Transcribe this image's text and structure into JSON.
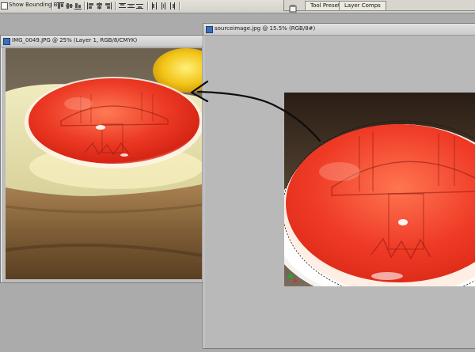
{
  "options_bar": {
    "show_bounding_box_label": "Show Bounding Box"
  },
  "palette_well": {
    "tabs": [
      {
        "label": "Tool Presets"
      },
      {
        "label": "Layer Comps"
      }
    ]
  },
  "documents": [
    {
      "title": "IMG_0049.JPG @ 25% (Layer 1, RGB/8/CMYK)"
    },
    {
      "title": "sourceimage.jpg @ 15.5% (RGB/8#)"
    }
  ],
  "colors": {
    "workspace": "#ababab",
    "mushroom_red": "#e8362a",
    "egg_yolk": "#f0c418",
    "toast": "#8a6a3e"
  },
  "icons": [
    "photoshop-document-icon",
    "palette-well-icon",
    "align-buttons-icon",
    "distribute-buttons-icon"
  ]
}
